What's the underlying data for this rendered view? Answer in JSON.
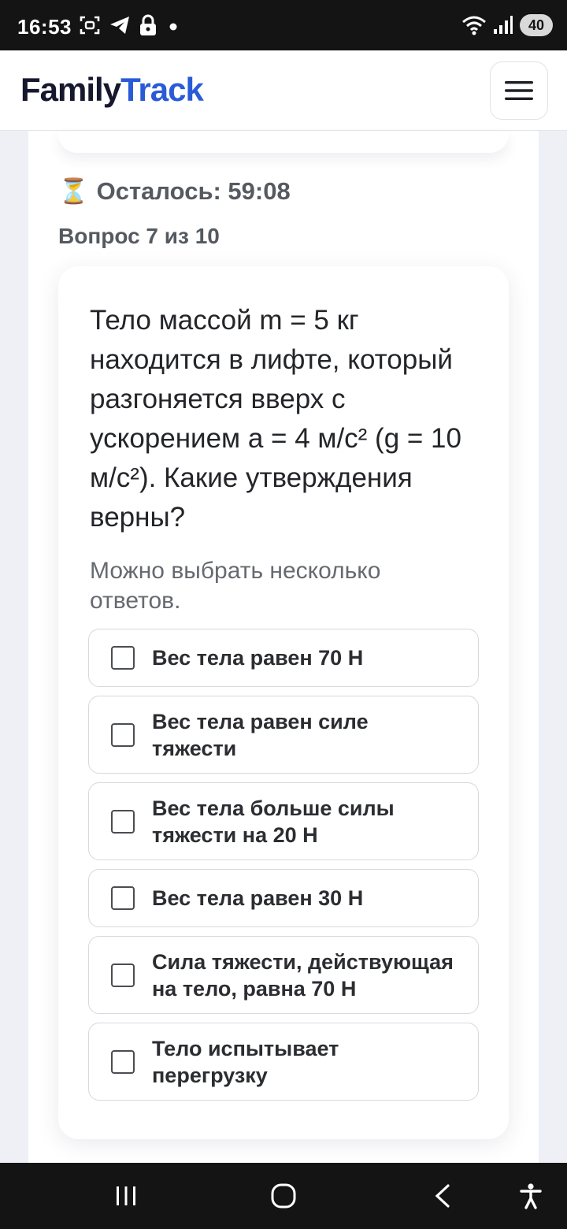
{
  "status_bar": {
    "time": "16:53",
    "battery": "40"
  },
  "header": {
    "logo_part1": "Family",
    "logo_part2": "Track",
    "accent_color": "#2a5bd7"
  },
  "quiz": {
    "timer_icon": "⏳",
    "timer_text": "Осталось: 59:08",
    "counter": "Вопрос 7 из 10",
    "question": "Тело массой m = 5 кг находится в лифте, который разгоняется вверх с ускорением a = 4 м/с² (g = 10 м/с²). Какие утверждения верны?",
    "hint": "Можно выбрать несколько ответов.",
    "options": [
      {
        "label": "Вес тела равен 70 Н",
        "checked": false
      },
      {
        "label": "Вес тела равен силе тяжести",
        "checked": false
      },
      {
        "label": "Вес тела больше силы тяжести на 20 Н",
        "checked": false
      },
      {
        "label": "Вес тела равен 30 Н",
        "checked": false
      },
      {
        "label": "Сила тяжести, действующая на тело, равна 70 Н",
        "checked": false
      },
      {
        "label": "Тело испытывает перегрузку",
        "checked": false
      }
    ]
  },
  "icons": {
    "status_left": [
      "screenshot-icon",
      "telegram-icon",
      "lock-icon",
      "dot-icon"
    ],
    "status_right": [
      "wifi-icon",
      "signal-icon",
      "battery-icon"
    ],
    "header": "hamburger-menu-icon",
    "nav": [
      "recent-apps-icon",
      "home-icon",
      "back-icon",
      "accessibility-icon"
    ]
  }
}
